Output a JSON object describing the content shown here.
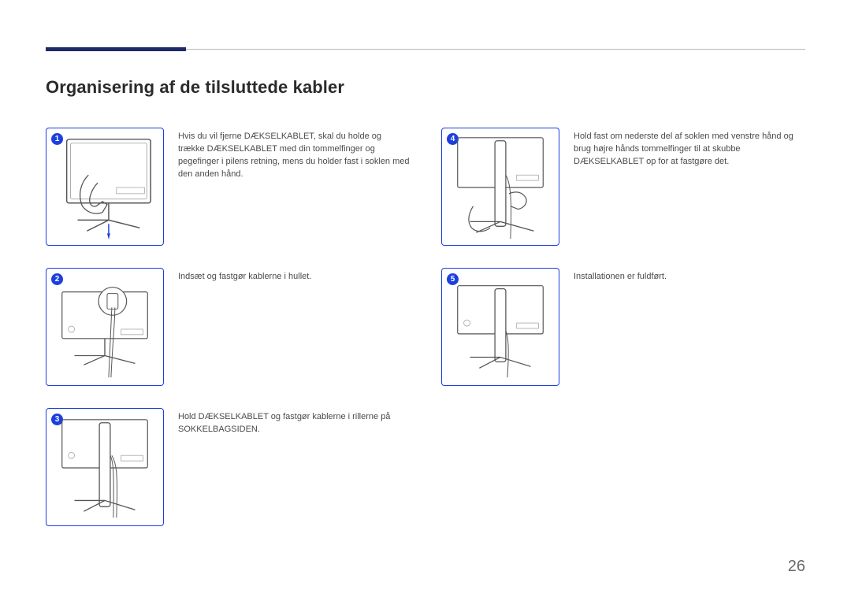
{
  "title": "Organisering af de tilsluttede kabler",
  "page_number": "26",
  "steps": {
    "s1": {
      "num": "1",
      "text": "Hvis du vil fjerne DÆKSELKABLET, skal du holde og trække DÆKSELKABLET med din tommelfinger og pegefinger i pilens retning, mens du holder fast i soklen med den anden hånd."
    },
    "s2": {
      "num": "2",
      "text": "Indsæt og fastgør kablerne i hullet."
    },
    "s3": {
      "num": "3",
      "text": "Hold DÆKSELKABLET og fastgør kablerne i rillerne på SOKKELBAGSIDEN."
    },
    "s4": {
      "num": "4",
      "text": "Hold fast om nederste del af soklen med venstre hånd og brug højre hånds tommelfinger til at skubbe DÆKSELKABLET op for at fastgøre det."
    },
    "s5": {
      "num": "5",
      "text": "Installationen er fuldført."
    }
  }
}
